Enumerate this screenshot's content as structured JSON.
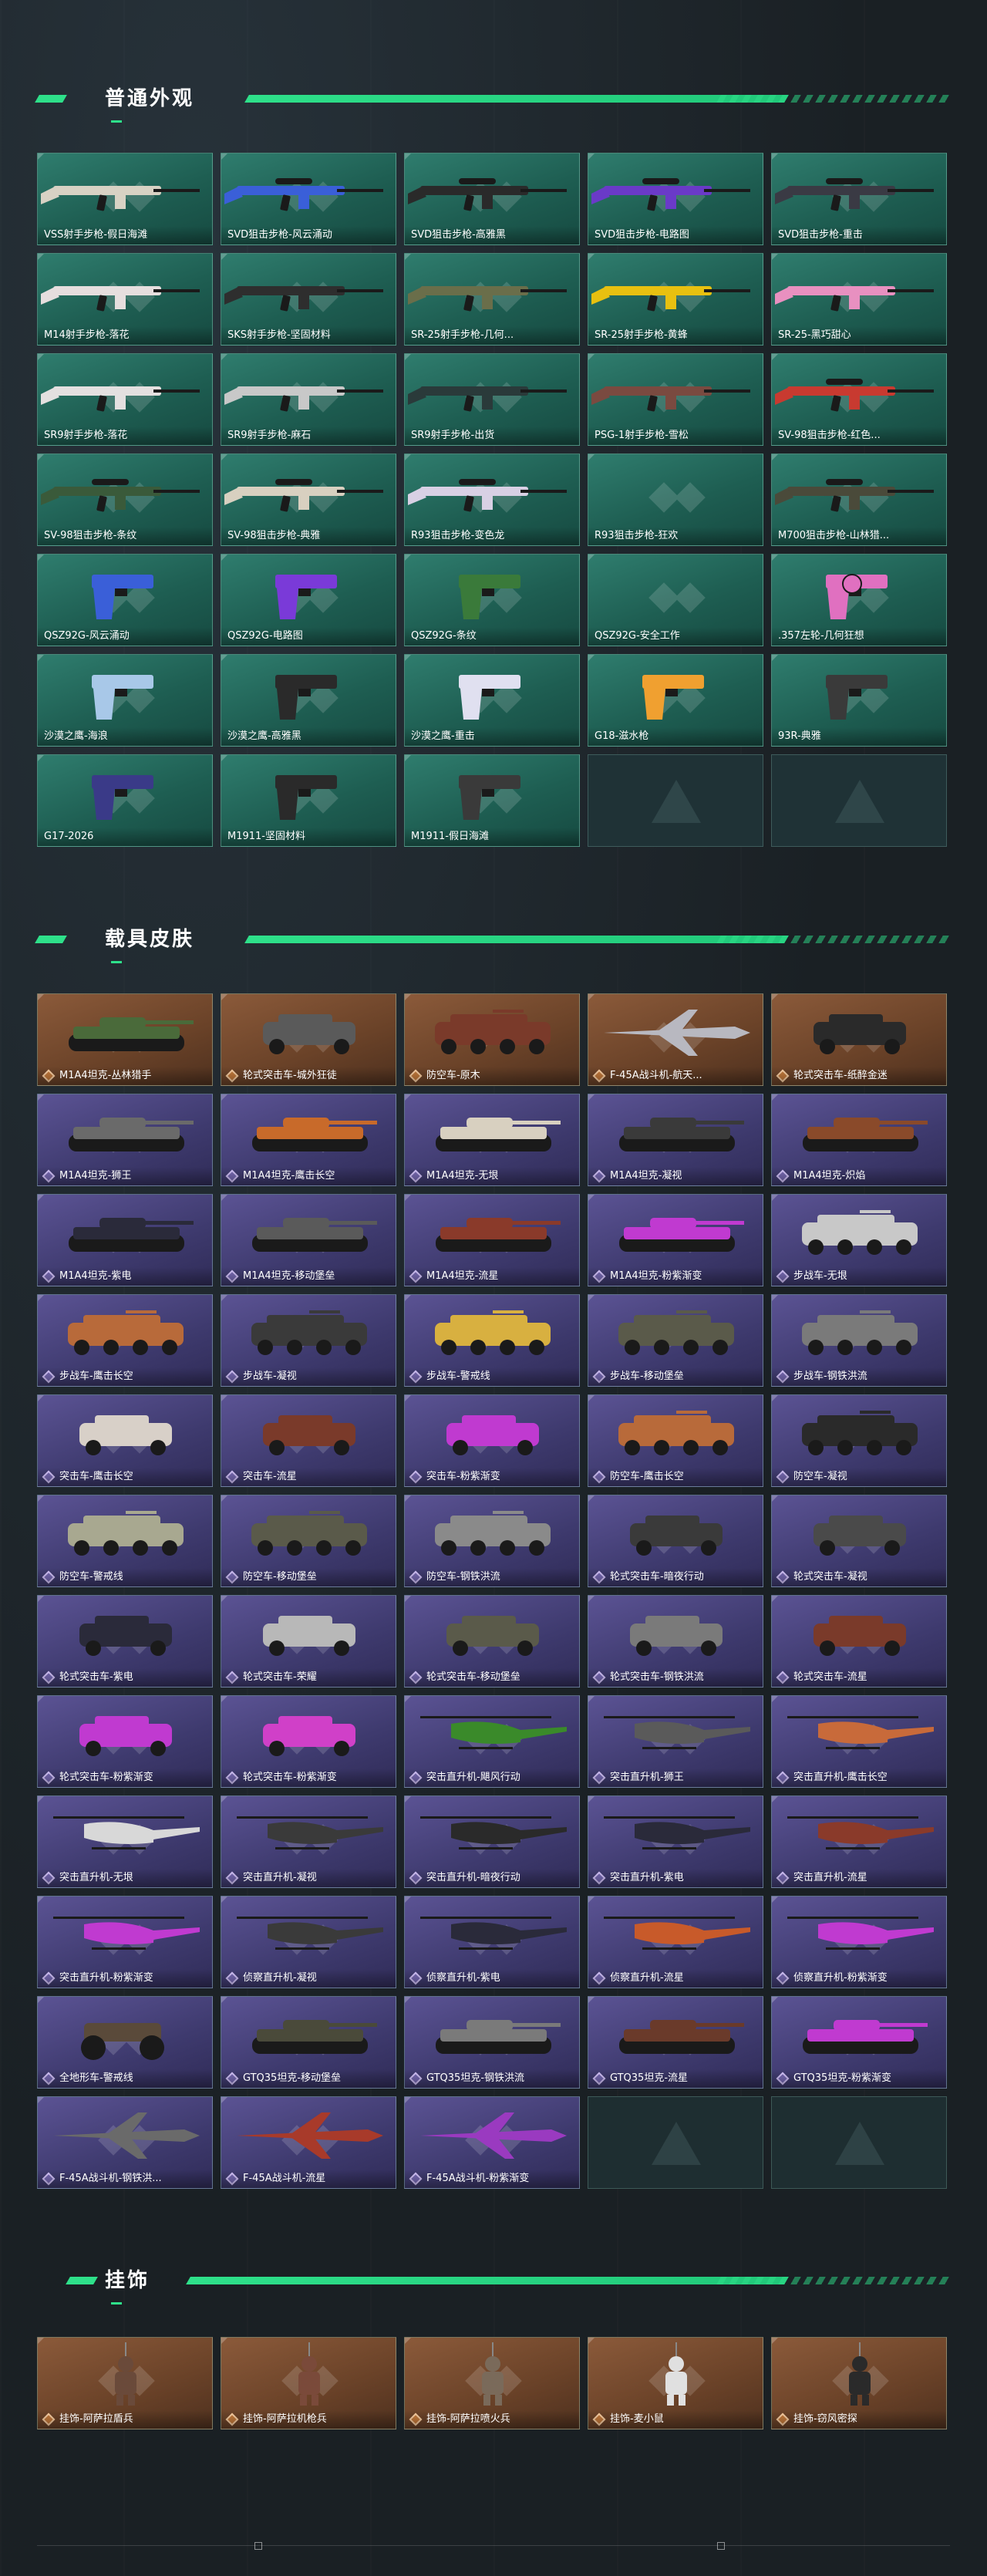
{
  "sections": [
    {
      "title": "普通外观"
    },
    {
      "title": "载具皮肤"
    },
    {
      "title": "挂饰"
    }
  ],
  "weapons": [
    {
      "label": "VSS射手步枪-假日海滩",
      "kind": "rifle",
      "color": "#d8d2c4"
    },
    {
      "label": "SVD狙击步枪-风云涌动",
      "kind": "sniper",
      "color": "#3a5fd8"
    },
    {
      "label": "SVD狙击步枪-高雅黑",
      "kind": "sniper",
      "color": "#2a2a2a"
    },
    {
      "label": "SVD狙击步枪-电路图",
      "kind": "sniper",
      "color": "#6a3ac8"
    },
    {
      "label": "SVD狙击步枪-重击",
      "kind": "sniper",
      "color": "#3a3a44"
    },
    {
      "label": "M14射手步枪-落花",
      "kind": "rifle",
      "color": "#e6dede"
    },
    {
      "label": "SKS射手步枪-坚固材料",
      "kind": "rifle",
      "color": "#2e2e2e"
    },
    {
      "label": "SR-25射手步枪-几何...",
      "kind": "rifle",
      "color": "#6a6e4a"
    },
    {
      "label": "SR-25射手步枪-黄蜂",
      "kind": "rifle",
      "color": "#e8c010"
    },
    {
      "label": "SR-25-黑巧甜心",
      "kind": "rifle",
      "color": "#e890c0"
    },
    {
      "label": "SR9射手步枪-落花",
      "kind": "rifle",
      "color": "#e4e0e0"
    },
    {
      "label": "SR9射手步枪-麻石",
      "kind": "rifle",
      "color": "#c8c8c8"
    },
    {
      "label": "SR9射手步枪-出货",
      "kind": "rifle",
      "color": "#2a3a3a"
    },
    {
      "label": "PSG-1射手步枪-雪松",
      "kind": "rifle",
      "color": "#7a4a40"
    },
    {
      "label": "SV-98狙击步枪-红色...",
      "kind": "sniper",
      "color": "#c83a30"
    },
    {
      "label": "SV-98狙击步枪-条纹",
      "kind": "sniper",
      "color": "#3a5a3a"
    },
    {
      "label": "SV-98狙击步枪-典雅",
      "kind": "sniper",
      "color": "#d8d0c0"
    },
    {
      "label": "R93狙击步枪-变色龙",
      "kind": "sniper",
      "color": "#d8d0e4"
    },
    {
      "label": "R93狙击步枪-狂欢",
      "kind": "none",
      "color": "#000000"
    },
    {
      "label": "M700狙击步枪-山林猎...",
      "kind": "sniper",
      "color": "#4a4a3a"
    },
    {
      "label": "QSZ92G-风云涌动",
      "kind": "pistol",
      "color": "#3a5fd8"
    },
    {
      "label": "QSZ92G-电路图",
      "kind": "pistol",
      "color": "#7a3ad8"
    },
    {
      "label": "QSZ92G-条纹",
      "kind": "pistol",
      "color": "#3a7a3a"
    },
    {
      "label": "QSZ92G-安全工作",
      "kind": "none",
      "color": "#000000"
    },
    {
      "label": ".357左轮-几何狂想",
      "kind": "revolver",
      "color": "#e070c0"
    },
    {
      "label": "沙漠之鹰-海浪",
      "kind": "pistol",
      "color": "#a8c8e8"
    },
    {
      "label": "沙漠之鹰-高雅黑",
      "kind": "pistol",
      "color": "#2a2a2a"
    },
    {
      "label": "沙漠之鹰-重击",
      "kind": "pistol",
      "color": "#e0e0f0"
    },
    {
      "label": "G18-滋水枪",
      "kind": "pistol",
      "color": "#f0a030"
    },
    {
      "label": "93R-典雅",
      "kind": "pistol",
      "color": "#3a3a3a"
    },
    {
      "label": "G17-2026",
      "kind": "pistol",
      "color": "#3a3a88"
    },
    {
      "label": "M1911-坚固材料",
      "kind": "pistol",
      "color": "#2a2a2a"
    },
    {
      "label": "M1911-假日海滩",
      "kind": "pistol",
      "color": "#3a3a3a"
    }
  ],
  "vehicles": [
    {
      "label": "M1A4坦克-丛林猎手",
      "kind": "tank",
      "color": "#4a6a3a",
      "rarity": "orange"
    },
    {
      "label": "轮式突击车-城外狂徒",
      "kind": "suv",
      "color": "#5a5a5a",
      "rarity": "orange"
    },
    {
      "label": "防空车-原木",
      "kind": "apc",
      "color": "#7a3a2a",
      "rarity": "orange"
    },
    {
      "label": "F-45A战斗机-航天...",
      "kind": "jet",
      "color": "#b8b8c0",
      "rarity": "orange"
    },
    {
      "label": "轮式突击车-纸醉金迷",
      "kind": "suv",
      "color": "#2a2a2a",
      "rarity": "orange"
    },
    {
      "label": "M1A4坦克-狮王",
      "kind": "tank",
      "color": "#6a6a6a",
      "rarity": "purple"
    },
    {
      "label": "M1A4坦克-鹰击长空",
      "kind": "tank",
      "color": "#c86a2a",
      "rarity": "purple"
    },
    {
      "label": "M1A4坦克-无垠",
      "kind": "tank",
      "color": "#d8d0c0",
      "rarity": "purple"
    },
    {
      "label": "M1A4坦克-凝视",
      "kind": "tank",
      "color": "#3a3a3a",
      "rarity": "purple"
    },
    {
      "label": "M1A4坦克-炽焰",
      "kind": "tank",
      "color": "#8a4a2a",
      "rarity": "purple"
    },
    {
      "label": "M1A4坦克-紫电",
      "kind": "tank",
      "color": "#2a2a3a",
      "rarity": "purple"
    },
    {
      "label": "M1A4坦克-移动堡垒",
      "kind": "tank",
      "color": "#5a5a5a",
      "rarity": "purple"
    },
    {
      "label": "M1A4坦克-流星",
      "kind": "tank",
      "color": "#8a3a2a",
      "rarity": "purple"
    },
    {
      "label": "M1A4坦克-粉紫渐变",
      "kind": "tank",
      "color": "#c03ad0",
      "rarity": "purple"
    },
    {
      "label": "步战车-无垠",
      "kind": "apc",
      "color": "#c8c8c8",
      "rarity": "purple"
    },
    {
      "label": "步战车-鹰击长空",
      "kind": "apc",
      "color": "#b86a3a",
      "rarity": "purple"
    },
    {
      "label": "步战车-凝视",
      "kind": "apc",
      "color": "#3a3a3a",
      "rarity": "purple"
    },
    {
      "label": "步战车-警戒线",
      "kind": "apc",
      "color": "#d8b040",
      "rarity": "purple"
    },
    {
      "label": "步战车-移动堡垒",
      "kind": "apc",
      "color": "#5a5a4a",
      "rarity": "purple"
    },
    {
      "label": "步战车-钢铁洪流",
      "kind": "apc",
      "color": "#7a7a7a",
      "rarity": "purple"
    },
    {
      "label": "突击车-鹰击长空",
      "kind": "suv",
      "color": "#d8d0c8",
      "rarity": "purple"
    },
    {
      "label": "突击车-流星",
      "kind": "suv",
      "color": "#7a3a2a",
      "rarity": "purple"
    },
    {
      "label": "突击车-粉紫渐变",
      "kind": "suv",
      "color": "#c03ad0",
      "rarity": "purple"
    },
    {
      "label": "防空车-鹰击长空",
      "kind": "apc",
      "color": "#b86a3a",
      "rarity": "purple"
    },
    {
      "label": "防空车-凝视",
      "kind": "apc",
      "color": "#2a2a2a",
      "rarity": "purple"
    },
    {
      "label": "防空车-警戒线",
      "kind": "apc",
      "color": "#a8a890",
      "rarity": "purple"
    },
    {
      "label": "防空车-移动堡垒",
      "kind": "apc",
      "color": "#5a5a4a",
      "rarity": "purple"
    },
    {
      "label": "防空车-钢铁洪流",
      "kind": "apc",
      "color": "#8a8a8a",
      "rarity": "purple"
    },
    {
      "label": "轮式突击车-暗夜行动",
      "kind": "suv",
      "color": "#3a3a3a",
      "rarity": "purple"
    },
    {
      "label": "轮式突击车-凝视",
      "kind": "suv",
      "color": "#4a4a4a",
      "rarity": "purple"
    },
    {
      "label": "轮式突击车-紫电",
      "kind": "suv",
      "color": "#2a2a3a",
      "rarity": "purple"
    },
    {
      "label": "轮式突击车-荣耀",
      "kind": "suv",
      "color": "#b8b8b8",
      "rarity": "purple"
    },
    {
      "label": "轮式突击车-移动堡垒",
      "kind": "suv",
      "color": "#5a5a4a",
      "rarity": "purple"
    },
    {
      "label": "轮式突击车-钢铁洪流",
      "kind": "suv",
      "color": "#7a7a7a",
      "rarity": "purple"
    },
    {
      "label": "轮式突击车-流星",
      "kind": "suv",
      "color": "#7a3a2a",
      "rarity": "purple"
    },
    {
      "label": "轮式突击车-粉紫渐变",
      "kind": "suv",
      "color": "#c03ad0",
      "rarity": "purple"
    },
    {
      "label": "轮式突击车-粉紫渐变",
      "kind": "suv",
      "color": "#d040c8",
      "rarity": "purple"
    },
    {
      "label": "突击直升机-飓风行动",
      "kind": "heli",
      "color": "#3a8a2a",
      "rarity": "purple"
    },
    {
      "label": "突击直升机-狮王",
      "kind": "heli",
      "color": "#5a5a5a",
      "rarity": "purple"
    },
    {
      "label": "突击直升机-鹰击长空",
      "kind": "heli",
      "color": "#c86a3a",
      "rarity": "purple"
    },
    {
      "label": "突击直升机-无垠",
      "kind": "heli",
      "color": "#d8d8d8",
      "rarity": "purple"
    },
    {
      "label": "突击直升机-凝视",
      "kind": "heli",
      "color": "#3a3a3a",
      "rarity": "purple"
    },
    {
      "label": "突击直升机-暗夜行动",
      "kind": "heli",
      "color": "#2a2a2a",
      "rarity": "purple"
    },
    {
      "label": "突击直升机-紫电",
      "kind": "heli",
      "color": "#2a2a3a",
      "rarity": "purple"
    },
    {
      "label": "突击直升机-流星",
      "kind": "heli",
      "color": "#8a3a2a",
      "rarity": "purple"
    },
    {
      "label": "突击直升机-粉紫渐变",
      "kind": "heli",
      "color": "#c03ad0",
      "rarity": "purple"
    },
    {
      "label": "侦察直升机-凝视",
      "kind": "heli",
      "color": "#3a3a3a",
      "rarity": "purple"
    },
    {
      "label": "侦察直升机-紫电",
      "kind": "heli",
      "color": "#2a2a3a",
      "rarity": "purple"
    },
    {
      "label": "侦察直升机-流星",
      "kind": "heli",
      "color": "#c85a2a",
      "rarity": "purple"
    },
    {
      "label": "侦察直升机-粉紫渐变",
      "kind": "heli",
      "color": "#c03ad0",
      "rarity": "purple"
    },
    {
      "label": "全地形车-警戒线",
      "kind": "atv",
      "color": "#5a4a3a",
      "rarity": "purple"
    },
    {
      "label": "GTQ35坦克-移动堡垒",
      "kind": "tank",
      "color": "#4a4a3a",
      "rarity": "purple"
    },
    {
      "label": "GTQ35坦克-钢铁洪流",
      "kind": "tank",
      "color": "#7a7a7a",
      "rarity": "purple"
    },
    {
      "label": "GTQ35坦克-流星",
      "kind": "tank",
      "color": "#6a3a2a",
      "rarity": "purple"
    },
    {
      "label": "GTQ35坦克-粉紫渐变",
      "kind": "tank",
      "color": "#c03ad0",
      "rarity": "purple"
    },
    {
      "label": "F-45A战斗机-钢铁洪...",
      "kind": "jet",
      "color": "#6a6a6a",
      "rarity": "purple"
    },
    {
      "label": "F-45A战斗机-流星",
      "kind": "jet",
      "color": "#a83a2a",
      "rarity": "purple"
    },
    {
      "label": "F-45A战斗机-粉紫渐变",
      "kind": "jet",
      "color": "#9a3ac0",
      "rarity": "purple"
    }
  ],
  "charms": [
    {
      "label": "挂饰-阿萨拉盾兵",
      "color": "#6a4a3a"
    },
    {
      "label": "挂饰-阿萨拉机枪兵",
      "color": "#7a4a3a"
    },
    {
      "label": "挂饰-阿萨拉喷火兵",
      "color": "#7a6a5a"
    },
    {
      "label": "挂饰-麦小鼠",
      "color": "#e0e0e0"
    },
    {
      "label": "挂饰-窃风密探",
      "color": "#2a2a2a"
    }
  ]
}
